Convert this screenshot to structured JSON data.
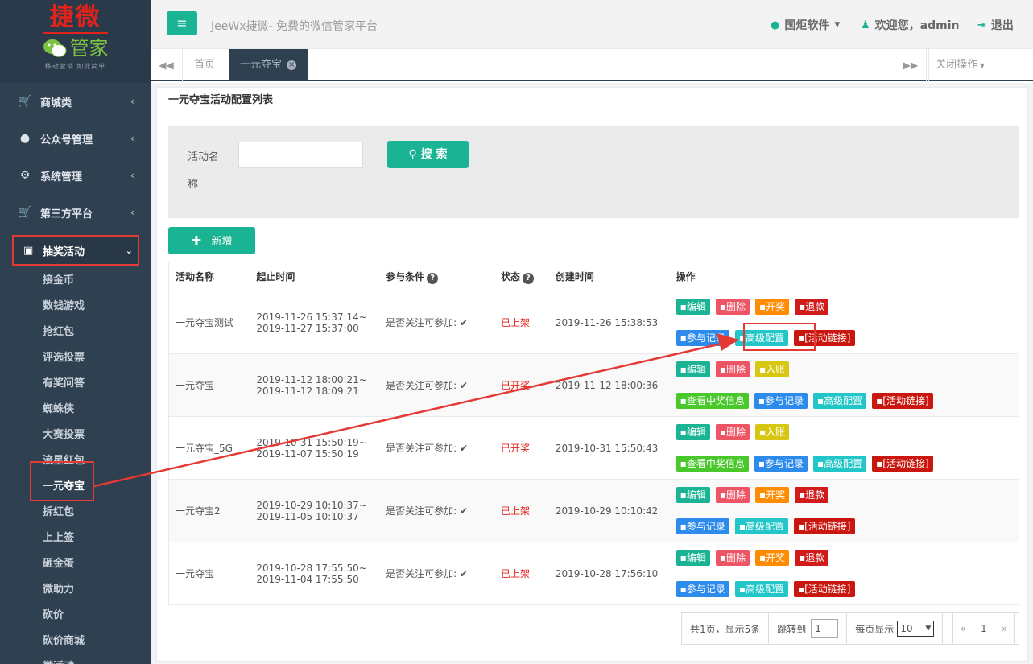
{
  "logo": {
    "line1": "捷微",
    "line2": "管家",
    "slogan": "移动营销 如此简单"
  },
  "header": {
    "site_title": "JeeWx捷微- 免费的微信管家平台",
    "company": "国炬软件",
    "welcome": "欢迎您，admin",
    "logout": "退出"
  },
  "sidebar": {
    "items": [
      {
        "label": "商城类",
        "icon": "cart-icon"
      },
      {
        "label": "公众号管理",
        "icon": "wechat-icon"
      },
      {
        "label": "系统管理",
        "icon": "gear-icon"
      },
      {
        "label": "第三方平台",
        "icon": "cart-icon"
      }
    ],
    "active": {
      "label": "抽奖活动",
      "icon": "gift-icon"
    },
    "sub": [
      "接金币",
      "数钱游戏",
      "抢红包",
      "评选投票",
      "有奖问答",
      "蜘蛛侠",
      "大赛投票",
      "流星红包",
      "一元夺宝",
      "拆红包",
      "上上签",
      "砸金蛋",
      "微助力",
      "砍价",
      "砍价商城",
      "微活动"
    ],
    "current": "一元夺宝"
  },
  "tabs": {
    "home": "首页",
    "active": "一元夺宝",
    "close_ops": "关闭操作"
  },
  "panel": {
    "title": "一元夺宝活动配置列表",
    "search_label": "活动名称",
    "search_button": "搜 索",
    "add_button": "新增"
  },
  "table": {
    "headers": [
      "活动名称",
      "起止时间",
      "参与条件",
      "状态",
      "创建时间",
      "操作"
    ],
    "rows": [
      {
        "name": "一元夺宝测试",
        "start": "2019-11-26 15:37:14~",
        "end": "2019-11-27 15:37:00",
        "cond": "是否关注可参加:",
        "status": "已上架",
        "created": "2019-11-26 15:38:53",
        "type": "a"
      },
      {
        "name": "一元夺宝",
        "start": "2019-11-12 18:00:21~",
        "end": "2019-11-12 18:09:21",
        "cond": "是否关注可参加:",
        "status": "已开奖",
        "created": "2019-11-12 18:00:36",
        "type": "b"
      },
      {
        "name": "一元夺宝_5G",
        "start": "2019-10-31 15:50:19~",
        "end": "2019-11-07 15:50:19",
        "cond": "是否关注可参加:",
        "status": "已开奖",
        "created": "2019-10-31 15:50:43",
        "type": "b"
      },
      {
        "name": "一元夺宝2",
        "start": "2019-10-29 10:10:37~",
        "end": "2019-11-05 10:10:37",
        "cond": "是否关注可参加:",
        "status": "已上架",
        "created": "2019-10-29 10:10:42",
        "type": "a"
      },
      {
        "name": "一元夺宝",
        "start": "2019-10-28 17:55:50~",
        "end": "2019-11-04 17:55:50",
        "cond": "是否关注可参加:",
        "status": "已上架",
        "created": "2019-10-28 17:56:10",
        "type": "a"
      }
    ],
    "ops": {
      "edit": "编辑",
      "delete": "删除",
      "open": "开奖",
      "refund": "退款",
      "records": "参与记录",
      "advanced": "高级配置",
      "link": "[活动链接]",
      "account": "入账",
      "winners": "查看中奖信息"
    }
  },
  "pager": {
    "summary": "共1页，显示5条",
    "jump": "跳转到",
    "jump_value": "1",
    "per_page": "每页显示",
    "per_page_value": "10",
    "prev": "«",
    "page": "1",
    "next": "»"
  }
}
